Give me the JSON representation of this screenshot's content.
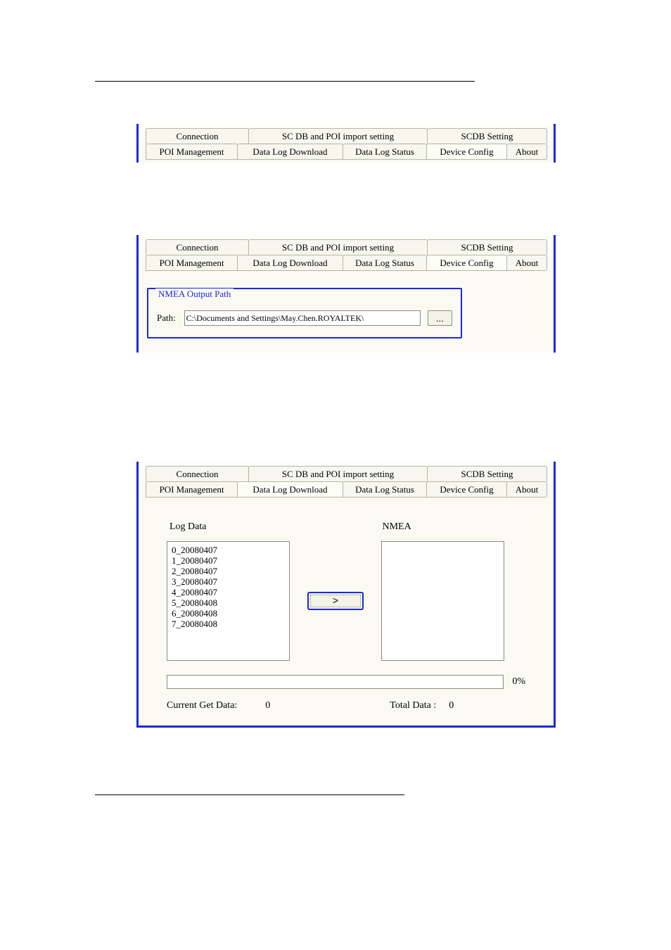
{
  "tabs_row1": {
    "connection": "Connection",
    "scdb_poi": "SC DB and POI import setting",
    "scdb_setting": "SCDB  Setting"
  },
  "tabs_row2": {
    "poi_management": "POI Management",
    "data_log_download": "Data Log Download",
    "data_log_status": "Data Log Status",
    "device_config": "Device Config",
    "about": "About"
  },
  "nmea_group": {
    "legend": "NMEA Output Path",
    "path_label": "Path:",
    "path_value": "C:\\Documents and Settings\\May.Chen.ROYALTEK\\",
    "browse_label": "..."
  },
  "download": {
    "log_data_label": "Log Data",
    "nmea_label": "NMEA",
    "items": [
      "0_20080407",
      "1_20080407",
      "2_20080407",
      "3_20080407",
      "4_20080407",
      "5_20080408",
      "6_20080408",
      "7_20080408"
    ],
    "transfer_label": ">",
    "progress_pct": "0%",
    "current_label": "Current Get Data:",
    "current_value": "0",
    "total_label": "Total Data :",
    "total_value": "0"
  }
}
